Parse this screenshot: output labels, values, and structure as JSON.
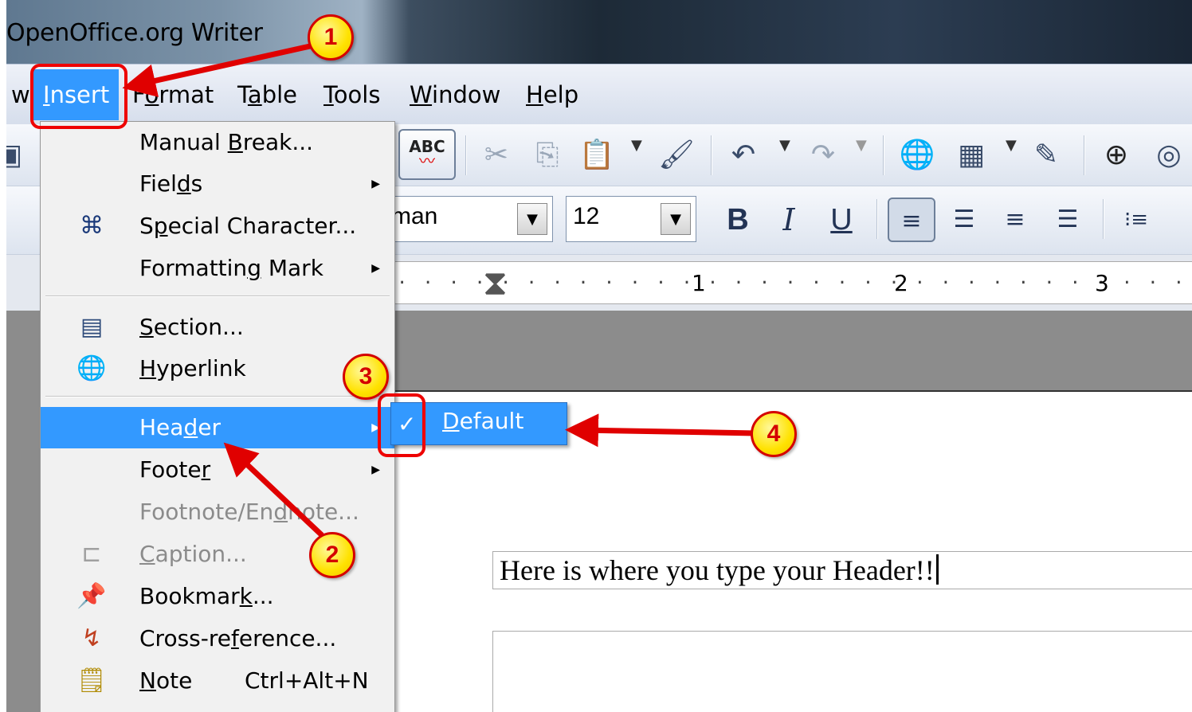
{
  "window": {
    "title": "OpenOffice.org Writer"
  },
  "menubar": {
    "items": [
      {
        "label_pre": "",
        "label_acc": "",
        "label_post": "w"
      },
      {
        "label_pre": "",
        "label_acc": "I",
        "label_post": "nsert"
      },
      {
        "label_pre": "F",
        "label_acc": "o",
        "label_post": "rmat"
      },
      {
        "label_pre": "T",
        "label_acc": "a",
        "label_post": "ble"
      },
      {
        "label_pre": "",
        "label_acc": "T",
        "label_post": "ools"
      },
      {
        "label_pre": "",
        "label_acc": "W",
        "label_post": "indow"
      },
      {
        "label_pre": "",
        "label_acc": "H",
        "label_post": "elp"
      }
    ]
  },
  "toolbar": {
    "spellcheck_label": "ABC",
    "font_name": "man",
    "font_size": "12",
    "bold_label": "B",
    "italic_label": "I",
    "underline_label": "U"
  },
  "ruler": {
    "marks": [
      "1",
      "2",
      "3"
    ]
  },
  "insert_menu": {
    "items": [
      {
        "pre": "Manual ",
        "acc": "B",
        "post": "reak...",
        "icon": "",
        "submenu": false,
        "disabled": false
      },
      {
        "pre": "Fiel",
        "acc": "d",
        "post": "s",
        "icon": "",
        "submenu": true,
        "disabled": false
      },
      {
        "pre": "S",
        "acc": "p",
        "post": "ecial Character...",
        "icon": "special-character-icon",
        "submenu": false,
        "disabled": false
      },
      {
        "pre": "Formattin",
        "acc": "g",
        "post": " Mark",
        "icon": "",
        "submenu": true,
        "disabled": false
      },
      {
        "pre": "",
        "acc": "S",
        "post": "ection...",
        "icon": "section-icon",
        "submenu": false,
        "disabled": false
      },
      {
        "pre": "",
        "acc": "H",
        "post": "yperlink",
        "icon": "hyperlink-icon",
        "submenu": false,
        "disabled": false
      },
      {
        "pre": "Hea",
        "acc": "d",
        "post": "er",
        "icon": "",
        "submenu": true,
        "disabled": false
      },
      {
        "pre": "Foote",
        "acc": "r",
        "post": "",
        "icon": "",
        "submenu": true,
        "disabled": false
      },
      {
        "pre": "Footnote/En",
        "acc": "d",
        "post": "note...",
        "icon": "",
        "submenu": false,
        "disabled": true
      },
      {
        "pre": "",
        "acc": "C",
        "post": "aption...",
        "icon": "caption-icon",
        "submenu": false,
        "disabled": true
      },
      {
        "pre": "Bookmar",
        "acc": "k",
        "post": "...",
        "icon": "bookmark-icon",
        "submenu": false,
        "disabled": false
      },
      {
        "pre": "Cross-re",
        "acc": "f",
        "post": "erence...",
        "icon": "cross-reference-icon",
        "submenu": false,
        "disabled": false
      },
      {
        "pre": "",
        "acc": "N",
        "post": "ote",
        "icon": "note-icon",
        "submenu": false,
        "disabled": false,
        "shortcut": "Ctrl+Alt+N"
      }
    ]
  },
  "header_submenu": {
    "pre": "",
    "acc": "D",
    "post": "efault",
    "checked": true
  },
  "document": {
    "header_text": "Here is where you type your Header!!"
  },
  "annotations": {
    "step1": "1",
    "step2": "2",
    "step3": "3",
    "step4": "4"
  },
  "colors": {
    "menu_highlight": "#3399ff",
    "annotation_red": "#e00000",
    "badge_yellow": "#ffe200"
  }
}
